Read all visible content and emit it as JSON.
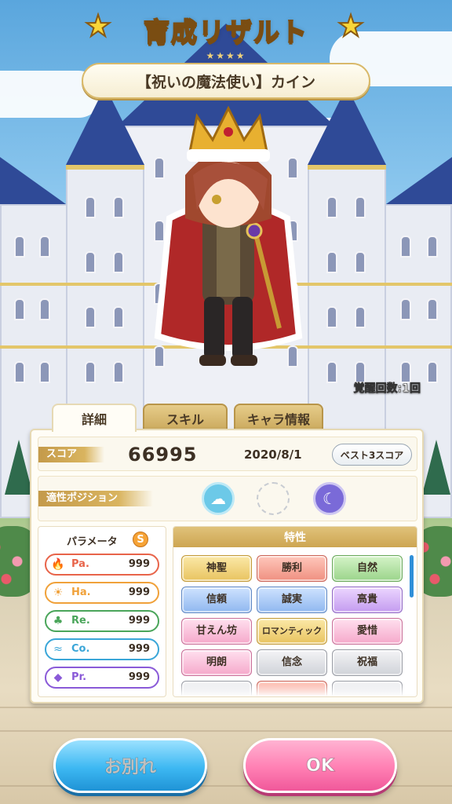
{
  "header": {
    "title": "育成リザルト",
    "rank_stars": "★★★★",
    "character_name": "【祝いの魔法使い】カイン"
  },
  "character": {
    "awakening_text": "覚醒回数:1回"
  },
  "tabs": [
    {
      "label": "詳細",
      "active": true
    },
    {
      "label": "スキル",
      "active": false
    },
    {
      "label": "キャラ情報",
      "active": false
    }
  ],
  "score": {
    "label": "スコア",
    "value": "66995",
    "date": "2020/8/1",
    "best_button": "ベスト3スコア"
  },
  "position": {
    "label": "適性ポジション",
    "icons": [
      "cloud-icon",
      "empty-slot",
      "moon-icon"
    ]
  },
  "parameters": {
    "title": "パラメータ",
    "rank": "S",
    "items": [
      {
        "name": "Pa.",
        "value": "999",
        "icon": "fire-icon",
        "color": "#e8644a"
      },
      {
        "name": "Ha.",
        "value": "999",
        "icon": "sun-icon",
        "color": "#f0a13a"
      },
      {
        "name": "Re.",
        "value": "999",
        "icon": "clover-icon",
        "color": "#4aa55a"
      },
      {
        "name": "Co.",
        "value": "999",
        "icon": "wave-icon",
        "color": "#3aa6d8"
      },
      {
        "name": "Pr.",
        "value": "999",
        "icon": "gem-icon",
        "color": "#8a5ad8"
      }
    ]
  },
  "traits": {
    "title": "特性",
    "items": [
      {
        "label": "神聖",
        "style": "t-gold"
      },
      {
        "label": "勝利",
        "style": "t-red"
      },
      {
        "label": "自然",
        "style": "t-green"
      },
      {
        "label": "信頼",
        "style": "t-blue"
      },
      {
        "label": "誠実",
        "style": "t-blue"
      },
      {
        "label": "高貴",
        "style": "t-purple"
      },
      {
        "label": "甘えん坊",
        "style": "t-pink"
      },
      {
        "label": "ロマンティック",
        "style": "t-gold"
      },
      {
        "label": "愛惜",
        "style": "t-pink"
      },
      {
        "label": "明朗",
        "style": "t-pink"
      },
      {
        "label": "信念",
        "style": "t-silver"
      },
      {
        "label": "祝福",
        "style": "t-silver"
      }
    ]
  },
  "buttons": {
    "farewell": "お別れ",
    "ok": "OK"
  },
  "colors": {
    "accent_gold": "#d9b45f",
    "button_blue": "#3db8f2",
    "button_pink": "#ff7fb3"
  }
}
